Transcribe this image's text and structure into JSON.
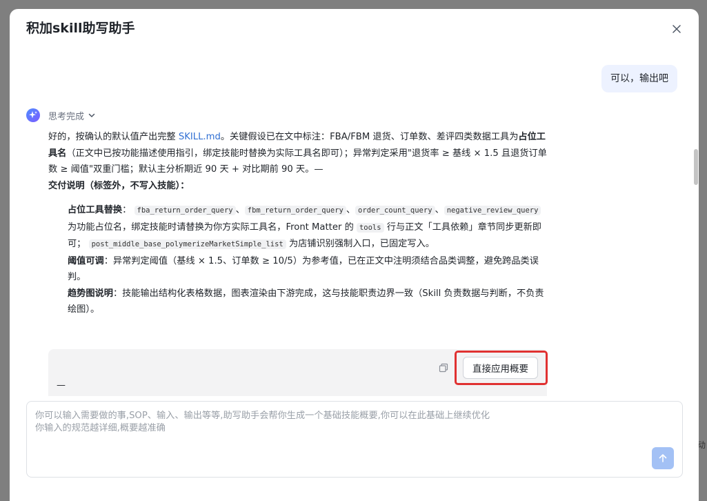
{
  "modal": {
    "title": "积加skill助写助手"
  },
  "backdrop": {
    "edge_text": "动"
  },
  "chat": {
    "user_message": "可以，输出吧",
    "thinking_label": "思考完成",
    "answer": {
      "intro_1": "好的，按确认的默认值产出完整 ",
      "intro_link": "SKILL.md",
      "intro_2": "。关键假设已在文中标注：FBA/FBM 退货、订单数、差评四类数据工具为",
      "intro_bold": "占位工具名",
      "intro_3": "（正文中已按功能描述使用指引，绑定技能时替换为实际工具名即可）；异常判定采用\"退货率 ≥ 基线 × 1.5 且退货订单数 ≥ 阈值\"双重门槛；默认主分析期近 90 天 + 对比期前 90 天。—",
      "section_title": "交付说明（标签外，不写入技能）：",
      "bullet1_label": "占位工具替换",
      "bullet1_colon": "：",
      "code1": "fba_return_order_query",
      "code2": "fbm_return_order_query",
      "code3": "order_count_query",
      "code4": "negative_review_query",
      "sep": "、",
      "bullet1_text_a": "为功能占位名，绑定技能时请替换为你方实际工具名，Front Matter 的",
      "code5": "tools",
      "bullet1_text_b": "行与正文「工具依赖」章节同步更新即可；",
      "code6": "post_middle_base_polymerizeMarketSimple_list",
      "bullet1_text_c": "为店铺识别强制入口，已固定写入。",
      "bullet2_label": "阈值可调",
      "bullet2_text": "：异常判定阈值（基线 × 1.5、订单数 ≥ 10/5）为参考值，已在正文中注明须结合品类调整，避免跨品类误判。",
      "bullet3_label": "趋势图说明",
      "bullet3_text": "：技能输出结构化表格数据，图表渲染由下游完成，这与技能职责边界一致（Skill 负责数据与判断，不负责绘图）。"
    },
    "summary_block": {
      "apply_button": "直接应用概要",
      "dash": "—"
    }
  },
  "input": {
    "placeholder": "你可以输入需要做的事,SOP、输入、输出等等,助写助手会帮你生成一个基础技能概要,你可以在此基础上继续优化\n你输入的规范越详细,概要越准确",
    "value": ""
  },
  "colors": {
    "accent": "#2f6fd3",
    "user_bubble": "#edf2ff",
    "highlight": "#e03131",
    "send_button": "#a3c1f5"
  },
  "icons": {
    "close": "close-icon",
    "ai": "sparkle-icon",
    "chevron": "chevron-down-icon",
    "copy": "copy-icon",
    "send": "arrow-up-icon"
  }
}
